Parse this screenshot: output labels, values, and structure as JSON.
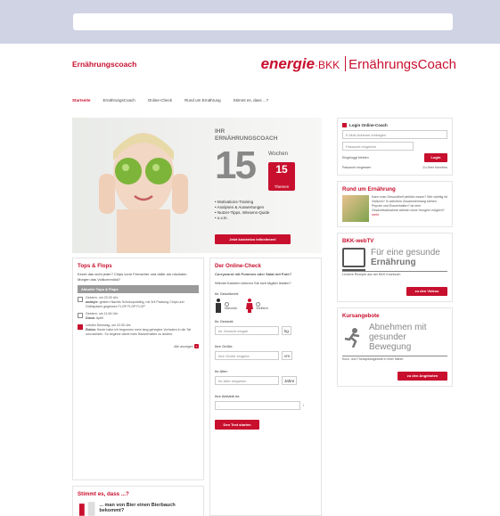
{
  "header": {
    "brand_left": "Ernährungscoach",
    "logo_word": "energie",
    "logo_bkk": "·BKK",
    "logo_coach": "ErnährungsCoach"
  },
  "nav": [
    "Startseite",
    "ErnährungsCoach",
    "Online-Check",
    "Rund um Ernährung",
    "Stimmt es, dass ...?"
  ],
  "hero": {
    "title1": "IHR",
    "title2": "ERNÄHRUNGSCOACH",
    "weeks_num": "15",
    "weeks": "Wochen",
    "badge_num": "15",
    "badge_label": "Themen",
    "list": [
      "Motivations-Training",
      "Analysen & Auswertungen",
      "Nutzer-Tipps, Wissens-Quide",
      "u.v.m."
    ],
    "button": "Jetzt kostenlos teilnehmen!"
  },
  "tops": {
    "title": "Tops & Flops",
    "intro": "Kennt das nicht jeder? Chips vorm Fernseher und dafür am nächsten Morgen das Vollkornmüsli?",
    "head": "Aktuelle Tops & Flops",
    "items": [
      {
        "date": "Gestern, um 20:30 Uhr",
        "user": "audaylx:",
        "text": "gestern Nachts Schokopudding, mit 3/4 Packung Chips und Gülbspasen gegessen TLOP FLOP FLOP"
      },
      {
        "date": "Gestern, um 11:54 Uhr",
        "user": "Diana:",
        "text": "Apfel"
      },
      {
        "date": "Letzten Dienstag, um 22:30 Uhr",
        "user": "Elatea:",
        "text": "Heute habe ich begonnen mein lang gehegtes Vorhaben in die Tat umzusetzen. So beginne damit mein Badverhalten zu ändern."
      }
    ],
    "more": "Alle anzeigen"
  },
  "stimmt": {
    "title": "Stimmt es, dass ...?",
    "text": "... man von Bier einen Bierbauch bekommt?"
  },
  "check": {
    "title": "Der Online-Check",
    "q": "Currywurst mit Pommes oder Salat mit Pute?",
    "q2": "Wieviel Kalorien können Sie sich täglich leisten?",
    "gender_label": "Ihr Geschlecht:",
    "male": "Männlich",
    "female": "Weiblich",
    "weight_label": "Ihr Gewicht:",
    "weight_ph": "Ihr Gewicht eingeb",
    "weight_unit": "kg",
    "height_label": "Ihre Größe:",
    "height_ph": "Ihre Größe eingebe",
    "height_unit": "cm",
    "age_label": "Ihr Alter:",
    "age_ph": "Ihr Alter eingeben",
    "age_unit": "Jahre",
    "activity_label": "Ihre Aktivität ist:",
    "activity_val": "-",
    "button": "Den Test starten"
  },
  "login": {
    "title": "Login Online-Coach",
    "email_ph": "E-Mail-Adresse eintragen",
    "pass_ph": "Passwort eingeben",
    "remember": "Eingeloggt bleiben",
    "button": "Login",
    "forgot": "Passwort vergessen",
    "register": "Zu Ihrer Kenntnis"
  },
  "rund": {
    "title": "Rund um Ernährung",
    "text": "Kann man Gesundheit wirklich essen? Wie wichtig ist Vollkorn? In welchem Zusammenhang stehen Psyche und Essverhalten? Ist eine Gewichtsabnahme wirklich ohne Hungern möglich?",
    "more": "mehr"
  },
  "tv": {
    "title": "BKK-webTV",
    "line1": "Für eine gesunde",
    "line2": "Ernährung",
    "caption": "Leckere Rezepte aus der BKK Kochbuch",
    "button": "zu den Videos"
  },
  "kurs": {
    "title": "Kursangebote",
    "line1": "Abnehmen mit",
    "line2": "gesunder",
    "line3": "Bewegung",
    "caption": "Kurs- und Therapieangebote in Ihrer Nähe!",
    "button": "zu den Angeboten"
  }
}
